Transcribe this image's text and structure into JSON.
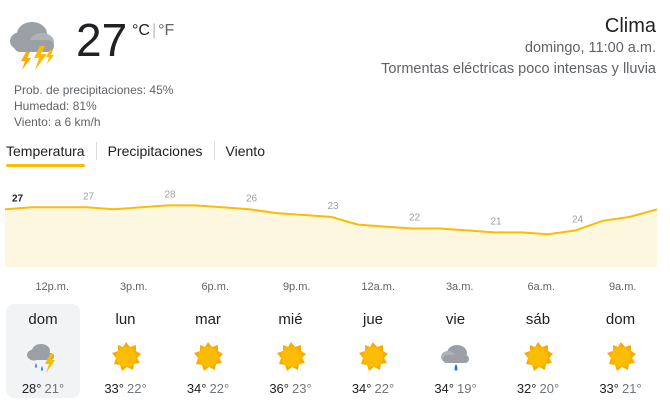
{
  "current": {
    "icon": "thunderstorm-icon",
    "temperature": "27",
    "unit_c": "°C",
    "unit_sep": "|",
    "unit_f": "°F",
    "precip": "Prob. de precipitaciones: 45%",
    "humidity": "Humedad: 81%",
    "wind": "Viento: a 6 km/h"
  },
  "location": {
    "title": "Clima",
    "time": "domingo, 11:00 a.m.",
    "condition": "Tormentas eléctricas poco intensas y lluvia"
  },
  "tabs": [
    {
      "label": "Temperatura",
      "active": true
    },
    {
      "label": "Precipitaciones",
      "active": false
    },
    {
      "label": "Viento",
      "active": false
    }
  ],
  "chart_data": {
    "type": "area",
    "x": [
      "11a.m.",
      "12p.m.",
      "1p.m.",
      "2p.m.",
      "3p.m.",
      "4p.m.",
      "5p.m.",
      "6p.m.",
      "7p.m.",
      "8p.m.",
      "9p.m.",
      "10p.m.",
      "11p.m.",
      "12a.m.",
      "1a.m.",
      "2a.m.",
      "3a.m.",
      "4a.m.",
      "5a.m.",
      "6a.m.",
      "7a.m.",
      "8a.m.",
      "9a.m.",
      "10a.m.",
      "11a.m."
    ],
    "values": [
      27,
      27.5,
      27.5,
      27.5,
      27,
      27.5,
      28,
      28,
      27.5,
      27,
      26,
      25.5,
      25,
      23,
      22.5,
      22,
      22,
      21.5,
      21,
      21,
      20.5,
      21.5,
      24,
      25,
      27
    ],
    "value_labels": [
      "27",
      "27",
      "28",
      "26",
      "23",
      "22",
      "21",
      "24"
    ],
    "tick_labels": [
      "12p.m.",
      "3p.m.",
      "6p.m.",
      "9p.m.",
      "12a.m.",
      "3a.m.",
      "6a.m.",
      "9a.m."
    ],
    "ylim": [
      12,
      32
    ],
    "colors": {
      "line": "#fbbc04",
      "fill": "#fef7e0",
      "label_first": "#202124",
      "label": "#9aa0a6",
      "ticks": "#5f6368"
    }
  },
  "days": [
    {
      "name": "dom",
      "icon": "thunderstorm-icon",
      "hi": "28°",
      "lo": "21°",
      "selected": true
    },
    {
      "name": "lun",
      "icon": "sun-icon",
      "hi": "33°",
      "lo": "22°",
      "selected": false
    },
    {
      "name": "mar",
      "icon": "sun-icon",
      "hi": "34°",
      "lo": "22°",
      "selected": false
    },
    {
      "name": "mié",
      "icon": "sun-icon",
      "hi": "36°",
      "lo": "23°",
      "selected": false
    },
    {
      "name": "jue",
      "icon": "sun-icon",
      "hi": "34°",
      "lo": "22°",
      "selected": false
    },
    {
      "name": "vie",
      "icon": "rain-cloud-icon",
      "hi": "34°",
      "lo": "19°",
      "selected": false
    },
    {
      "name": "sáb",
      "icon": "sun-icon",
      "hi": "32°",
      "lo": "20°",
      "selected": false
    },
    {
      "name": "dom",
      "icon": "sun-icon",
      "hi": "33°",
      "lo": "21°",
      "selected": false
    }
  ]
}
